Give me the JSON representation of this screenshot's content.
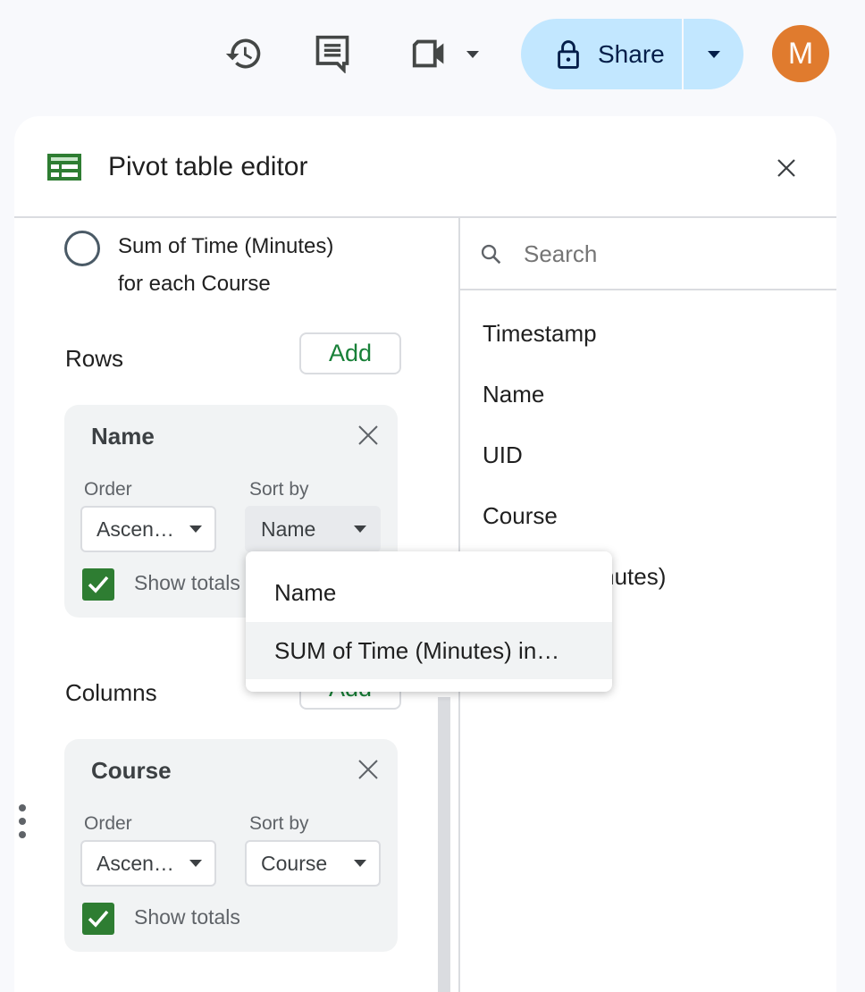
{
  "toolbar": {
    "share_label": "Share",
    "avatar_initial": "M"
  },
  "editor": {
    "title": "Pivot table editor",
    "suggestion": {
      "line1": "Sum of Time (Minutes)",
      "line2": "for each Course"
    },
    "rows": {
      "label": "Rows",
      "add_label": "Add",
      "card": {
        "name": "Name",
        "order_label": "Order",
        "order_value": "Ascen…",
        "sortby_label": "Sort by",
        "sortby_value": "Name",
        "show_totals": "Show totals"
      }
    },
    "columns": {
      "label": "Columns",
      "add_label": "Add",
      "card": {
        "name": "Course",
        "order_label": "Order",
        "order_value": "Ascen…",
        "sortby_label": "Sort by",
        "sortby_value": "Course",
        "show_totals": "Show totals"
      }
    },
    "search": {
      "placeholder": "Search"
    },
    "fields": [
      "Timestamp",
      "Name",
      "UID",
      "Course",
      "Time (Minutes)"
    ]
  },
  "sort_menu": {
    "items": [
      "Name",
      "SUM of Time (Minutes) in…"
    ]
  },
  "colors": {
    "accent_green": "#188038",
    "share_bg": "#c2e7ff",
    "avatar_bg": "#e07b2e"
  }
}
